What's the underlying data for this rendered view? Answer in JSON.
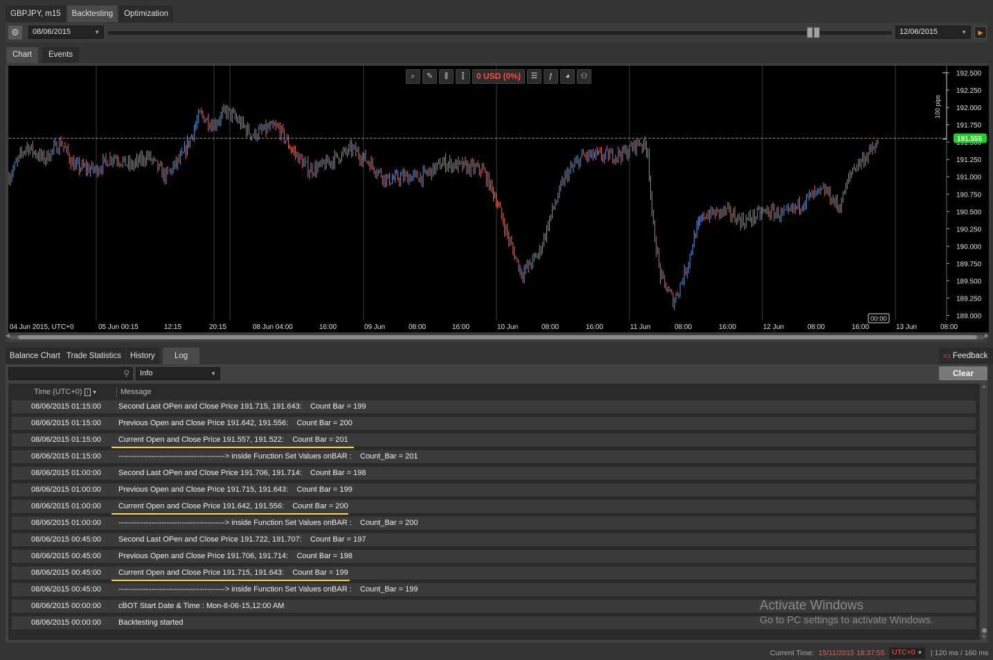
{
  "top_tabs": [
    "GBPJPY, m15",
    "Backtesting",
    "Optimization"
  ],
  "toolbar": {
    "start_date": "08/06/2015",
    "end_date": "12/06/2015"
  },
  "chart_tabs": [
    "Chart",
    "Events"
  ],
  "chart_toolbar": {
    "pnl": "0 USD (0%)"
  },
  "chart_data": {
    "type": "candlestick",
    "title": "",
    "symbol": "GBPJPY",
    "timeframe": "m15",
    "y_ticks": [
      "192.500",
      "192.250",
      "192.000",
      "191.750",
      "191.500",
      "191.250",
      "191.000",
      "190.750",
      "190.500",
      "190.250",
      "190.000",
      "189.750",
      "189.500",
      "189.250",
      "189.000"
    ],
    "ylim": [
      188.925,
      192.6
    ],
    "x_ticks": [
      "04 Jun 2015, UTC+0",
      "05 Jun 00:15",
      "12:15",
      "20:15",
      "08 Jun 04:00",
      "16:00",
      "09 Jun",
      "08:00",
      "16:00",
      "10 Jun",
      "08:00",
      "16:00",
      "11 Jun",
      "08:00",
      "16:00",
      "12 Jun",
      "08:00",
      "16:00",
      "13 Jun",
      "08:00"
    ],
    "current_price": "191.555",
    "current_price_value": 191.555,
    "scale_label": "100 pips",
    "time_marker": "00:00",
    "close_path": [
      [
        0,
        191.0
      ],
      [
        0.02,
        191.45
      ],
      [
        0.04,
        191.25
      ],
      [
        0.06,
        191.5
      ],
      [
        0.075,
        191.15
      ],
      [
        0.1,
        191.1
      ],
      [
        0.12,
        191.3
      ],
      [
        0.14,
        191.15
      ],
      [
        0.16,
        191.3
      ],
      [
        0.18,
        191.0
      ],
      [
        0.2,
        191.3
      ],
      [
        0.22,
        191.9
      ],
      [
        0.235,
        191.75
      ],
      [
        0.25,
        191.95
      ],
      [
        0.26,
        191.85
      ],
      [
        0.28,
        191.6
      ],
      [
        0.3,
        191.7
      ],
      [
        0.31,
        191.7
      ],
      [
        0.325,
        191.4
      ],
      [
        0.345,
        191.1
      ],
      [
        0.36,
        191.15
      ],
      [
        0.38,
        191.3
      ],
      [
        0.395,
        191.4
      ],
      [
        0.415,
        191.2
      ],
      [
        0.435,
        190.95
      ],
      [
        0.455,
        191.0
      ],
      [
        0.475,
        191.0
      ],
      [
        0.5,
        191.2
      ],
      [
        0.52,
        191.15
      ],
      [
        0.545,
        191.1
      ],
      [
        0.56,
        190.7
      ],
      [
        0.575,
        190.1
      ],
      [
        0.59,
        189.6
      ],
      [
        0.61,
        189.9
      ],
      [
        0.625,
        190.5
      ],
      [
        0.64,
        191.0
      ],
      [
        0.66,
        191.3
      ],
      [
        0.69,
        191.3
      ],
      [
        0.71,
        191.35
      ],
      [
        0.725,
        191.5
      ],
      [
        0.735,
        191.4
      ],
      [
        0.74,
        190.4
      ],
      [
        0.75,
        189.55
      ],
      [
        0.765,
        189.2
      ],
      [
        0.78,
        189.7
      ],
      [
        0.79,
        190.2
      ],
      [
        0.8,
        190.45
      ],
      [
        0.825,
        190.5
      ],
      [
        0.845,
        190.35
      ],
      [
        0.87,
        190.5
      ],
      [
        0.895,
        190.45
      ],
      [
        0.92,
        190.7
      ],
      [
        0.94,
        190.8
      ],
      [
        0.955,
        190.55
      ],
      [
        0.97,
        191.1
      ],
      [
        0.99,
        191.35
      ],
      [
        1.0,
        191.45
      ]
    ]
  },
  "bottom_tabs": [
    "Balance Chart",
    "Trade Statistics",
    "History",
    "Log"
  ],
  "feedback_label": "Feedback",
  "log": {
    "filter": "Info",
    "clear_label": "Clear",
    "col_time": "Time (UTC+0)",
    "col_message": "Message",
    "rows": [
      {
        "time": "08/06/2015 01:15:00",
        "message": "Second Last OPen and Close Price 191.715, 191.643:    Count Bar = 199"
      },
      {
        "time": "08/06/2015 01:15:00",
        "message": "Previous Open and Close Price 191.642, 191.556:    Count Bar = 200"
      },
      {
        "time": "08/06/2015 01:15:00",
        "message": "Current Open and Close Price 191.557, 191.522:    Count Bar = 201"
      },
      {
        "time": "08/06/2015 01:15:00",
        "message": "------------------------------------------> inside Function Set Values onBAR :    Count_Bar = 201"
      },
      {
        "time": "08/06/2015 01:00:00",
        "message": "Second Last OPen and Close Price 191.706, 191.714:    Count Bar = 198"
      },
      {
        "time": "08/06/2015 01:00:00",
        "message": "Previous Open and Close Price 191.715, 191.643:    Count Bar = 199"
      },
      {
        "time": "08/06/2015 01:00:00",
        "message": "Current Open and Close Price 191.642, 191.556:    Count Bar = 200"
      },
      {
        "time": "08/06/2015 01:00:00",
        "message": "------------------------------------------> inside Function Set Values onBAR :    Count_Bar = 200"
      },
      {
        "time": "08/06/2015 00:45:00",
        "message": "Second Last OPen and Close Price 191.722, 191.707:    Count Bar = 197"
      },
      {
        "time": "08/06/2015 00:45:00",
        "message": "Previous Open and Close Price 191.706, 191.714:    Count Bar = 198"
      },
      {
        "time": "08/06/2015 00:45:00",
        "message": "Current Open and Close Price 191.715, 191.643:    Count Bar = 199"
      },
      {
        "time": "08/06/2015 00:45:00",
        "message": "------------------------------------------> inside Function Set Values onBAR :    Count_Bar = 199"
      },
      {
        "time": "08/06/2015 00:00:00",
        "message": "cBOT Start Date & Time : Mon-8-06-15,12:00 AM"
      },
      {
        "time": "08/06/2015 00:00:00",
        "message": "Backtesting started"
      }
    ]
  },
  "watermark": {
    "line1": "Activate Windows",
    "line2": "Go to PC settings to activate Windows."
  },
  "status": {
    "label": "Current Time:",
    "time": "15/11/2015 18:37:55",
    "tz": "UTC+0",
    "latency": "| 120 ms / 160 ms"
  },
  "colors": {
    "bull": "#5b9bd5",
    "bear": "#e0705a",
    "price_line": "#e0705a",
    "price_badge": "#22cc22",
    "highlight": "#ffe000"
  }
}
